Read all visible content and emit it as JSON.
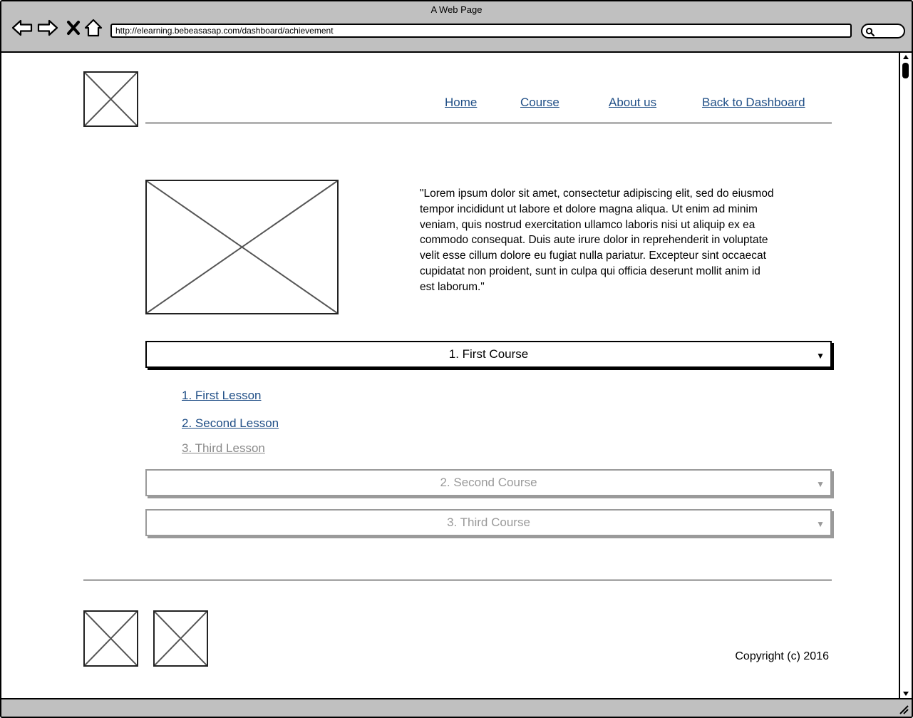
{
  "window": {
    "title": "A Web Page",
    "url": "http://elearning.bebeasasap.com/dashboard/achievement"
  },
  "nav": {
    "items": [
      {
        "label": "Home"
      },
      {
        "label": "Course"
      },
      {
        "label": "About us"
      },
      {
        "label": "Back to Dashboard"
      }
    ]
  },
  "intro": {
    "text": "\"Lorem ipsum dolor sit amet, consectetur adipiscing elit, sed do eiusmod tempor incididunt ut labore et dolore magna aliqua. Ut enim ad minim veniam, quis nostrud exercitation ullamco laboris nisi ut aliquip ex ea commodo consequat. Duis aute irure dolor in reprehenderit in voluptate velit esse cillum dolore eu fugiat nulla pariatur. Excepteur sint occaecat cupidatat non proident, sunt in culpa qui officia deserunt mollit anim id est laborum.\""
  },
  "courses": [
    {
      "label": "1. First Course",
      "expanded": true,
      "lessons": [
        {
          "label": "1. First Lesson",
          "state": "active"
        },
        {
          "label": "2. Second Lesson",
          "state": "active"
        },
        {
          "label": "3. Third Lesson",
          "state": "disabled"
        }
      ]
    },
    {
      "label": "2. Second Course",
      "expanded": false,
      "state": "disabled"
    },
    {
      "label": "3. Third Course",
      "expanded": false,
      "state": "disabled"
    }
  ],
  "footer": {
    "copyright": "Copyright (c) 2016"
  },
  "colors": {
    "chrome": "#c0c0c0",
    "link": "#1f4e86",
    "disabled": "#999999"
  },
  "icons": {
    "back": "back-arrow-icon",
    "forward": "forward-arrow-icon",
    "stop": "close-icon",
    "home": "home-icon",
    "search": "search-icon"
  }
}
